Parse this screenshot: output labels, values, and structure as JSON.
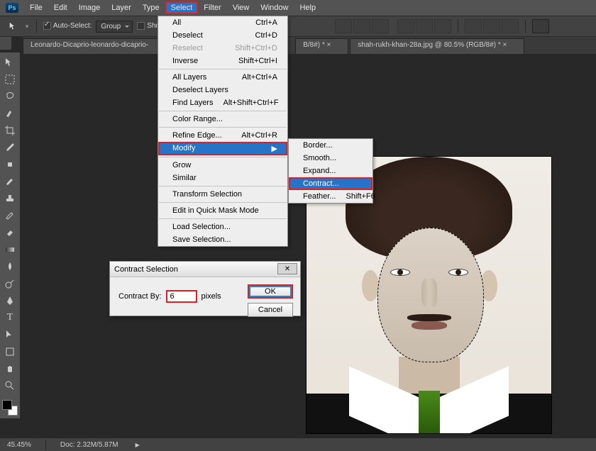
{
  "app": {
    "ps": "Ps"
  },
  "menubar": [
    "File",
    "Edit",
    "Image",
    "Layer",
    "Type",
    "Select",
    "Filter",
    "View",
    "Window",
    "Help"
  ],
  "options": {
    "auto_select": "Auto-Select:",
    "group": "Group",
    "show_tf": "Show Transform Controls"
  },
  "tabs": [
    "Leonardo-Dicaprio-leonardo-dicaprio-",
    "B/8#) * ×",
    "shah-rukh-khan-28a.jpg @ 80.5% (RGB/8#) * ×"
  ],
  "select_menu": [
    {
      "l": "All",
      "s": "Ctrl+A"
    },
    {
      "l": "Deselect",
      "s": "Ctrl+D"
    },
    {
      "l": "Reselect",
      "s": "Shift+Ctrl+D",
      "d": true
    },
    {
      "l": "Inverse",
      "s": "Shift+Ctrl+I"
    },
    {
      "sep": true
    },
    {
      "l": "All Layers",
      "s": "Alt+Ctrl+A"
    },
    {
      "l": "Deselect Layers",
      "s": ""
    },
    {
      "l": "Find Layers",
      "s": "Alt+Shift+Ctrl+F"
    },
    {
      "sep": true
    },
    {
      "l": "Color Range...",
      "s": ""
    },
    {
      "sep": true
    },
    {
      "l": "Refine Edge...",
      "s": "Alt+Ctrl+R"
    },
    {
      "l": "Modify",
      "s": "▶",
      "hi": true
    },
    {
      "sep": true
    },
    {
      "l": "Grow",
      "s": ""
    },
    {
      "l": "Similar",
      "s": ""
    },
    {
      "sep": true
    },
    {
      "l": "Transform Selection",
      "s": ""
    },
    {
      "sep": true
    },
    {
      "l": "Edit in Quick Mask Mode",
      "s": ""
    },
    {
      "sep": true
    },
    {
      "l": "Load Selection...",
      "s": ""
    },
    {
      "l": "Save Selection...",
      "s": ""
    }
  ],
  "modify_menu": [
    {
      "l": "Border...",
      "s": ""
    },
    {
      "l": "Smooth...",
      "s": ""
    },
    {
      "l": "Expand...",
      "s": ""
    },
    {
      "l": "Contract...",
      "s": "",
      "hi": true
    },
    {
      "l": "Feather...",
      "s": "Shift+F6"
    }
  ],
  "dialog": {
    "title": "Contract Selection",
    "label": "Contract By:",
    "value": "6",
    "unit": "pixels",
    "ok": "OK",
    "cancel": "Cancel"
  },
  "status": {
    "zoom": "45.45%",
    "doc": "Doc: 2.32M/5.87M"
  }
}
